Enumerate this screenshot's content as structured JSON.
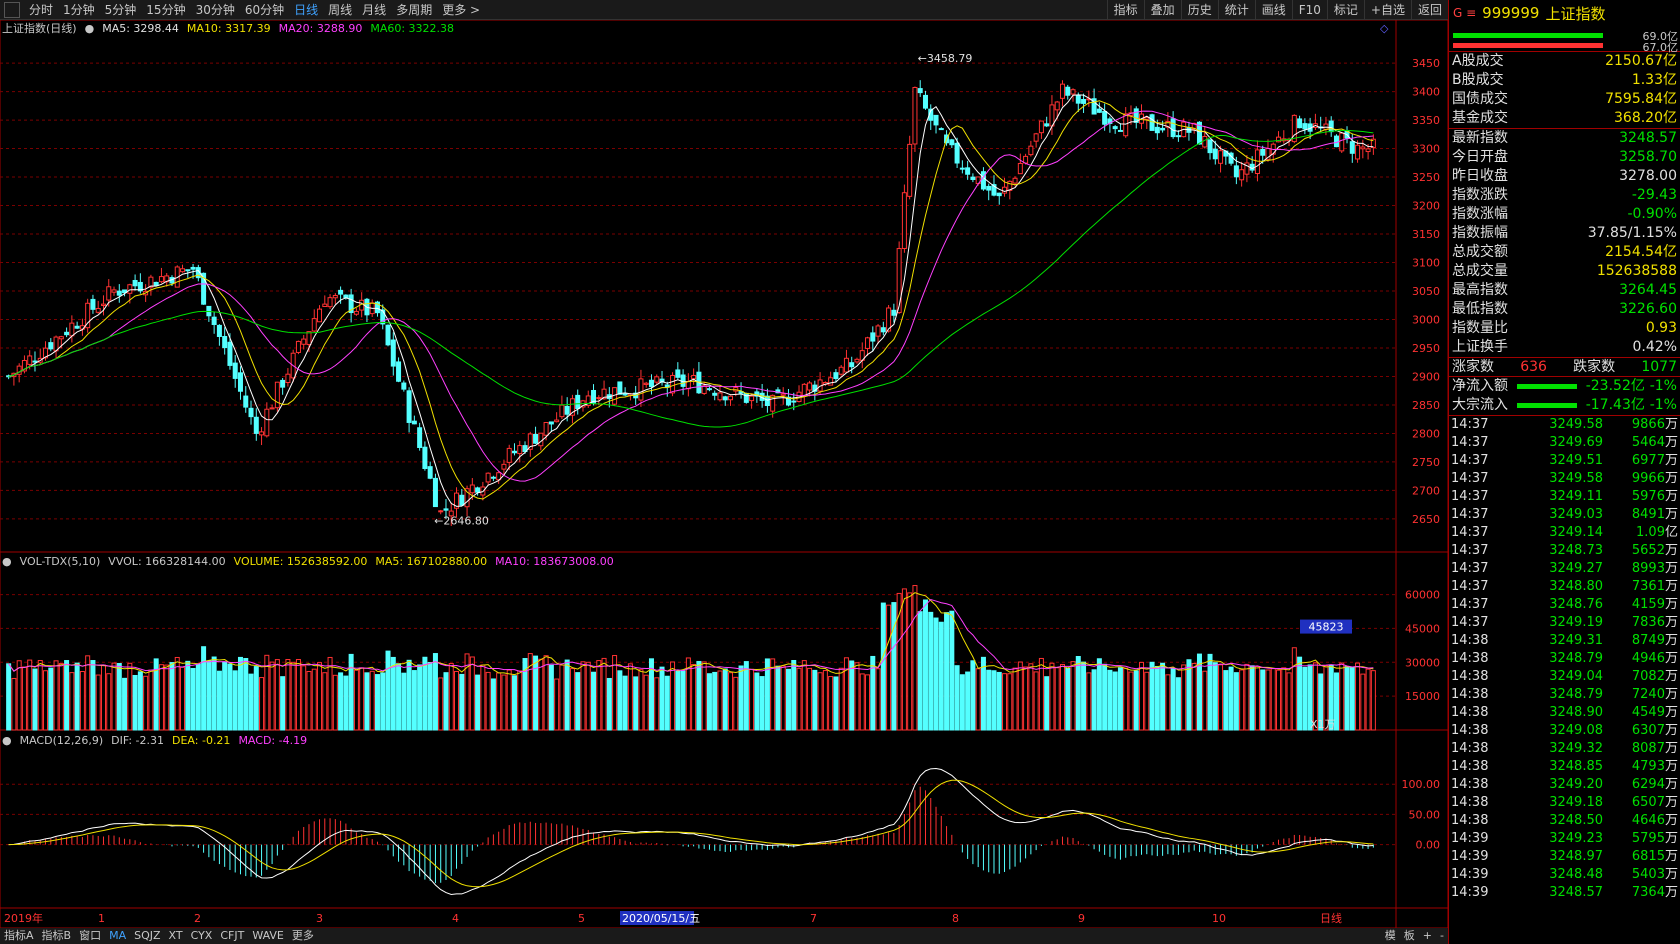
{
  "toolbar": {
    "periods": [
      "分时",
      "1分钟",
      "5分钟",
      "15分钟",
      "30分钟",
      "60分钟",
      "日线",
      "周线",
      "月线",
      "多周期",
      "更多 >"
    ],
    "active_period": "日线",
    "right_buttons": [
      "指标",
      "叠加",
      "历史",
      "统计",
      "画线",
      "F10",
      "标记",
      "+自选",
      "返回"
    ]
  },
  "main_legend": {
    "title": "上证指数(日线)",
    "ma5": "MA5: 3298.44",
    "ma10": "MA10: 3317.39",
    "ma20": "MA20: 3288.90",
    "ma60": "MA60: 3322.38",
    "high_label": "3458.79",
    "low_label": "2646.80"
  },
  "vol_legend": {
    "name": "VOL-TDX(5,10)",
    "vvol": "VVOL: 166328144.00",
    "volume": "VOLUME: 152638592.00",
    "ma5": "MA5: 167102880.00",
    "ma10": "MA10: 183673008.00",
    "cursor_value": "45823",
    "unit": "X1万"
  },
  "macd_legend": {
    "name": "MACD(12,26,9)",
    "dif": "DIF: -2.31",
    "dea": "DEA: -0.21",
    "macd": "MACD: -4.19"
  },
  "axes": {
    "price_ticks": [
      "3450",
      "3400",
      "3350",
      "3300",
      "3250",
      "3200",
      "3150",
      "3100",
      "3050",
      "3000",
      "2950",
      "2900",
      "2850",
      "2800",
      "2750",
      "2700",
      "2650"
    ],
    "vol_ticks": [
      "60000",
      "45000",
      "30000",
      "15000"
    ],
    "macd_ticks": [
      "100.00",
      "50.00",
      "0.00"
    ],
    "x_labels": [
      "2019年",
      "1",
      "2",
      "3",
      "4",
      "5",
      "2020/05/15/五",
      "7",
      "8",
      "9",
      "10",
      "日线"
    ]
  },
  "colors": {
    "up": "#ff3232",
    "down": "#54ffff",
    "ma5": "#ffffff",
    "ma10": "#f0e000",
    "ma20": "#ff40ff",
    "ma60": "#00e000",
    "grid": "#7a0000"
  },
  "chart_data": {
    "type": "candlestick",
    "ylim": [
      2620,
      3480
    ],
    "closes_key_points": [
      [
        0,
        2900
      ],
      [
        20,
        3050
      ],
      [
        35,
        3090
      ],
      [
        47,
        2800
      ],
      [
        60,
        3040
      ],
      [
        70,
        3010
      ],
      [
        82,
        2660
      ],
      [
        95,
        2760
      ],
      [
        110,
        2870
      ],
      [
        130,
        2890
      ],
      [
        145,
        2850
      ],
      [
        160,
        2920
      ],
      [
        168,
        3020
      ],
      [
        172,
        3400
      ],
      [
        178,
        3300
      ],
      [
        188,
        3210
      ],
      [
        200,
        3400
      ],
      [
        210,
        3350
      ],
      [
        225,
        3330
      ],
      [
        233,
        3250
      ],
      [
        245,
        3350
      ],
      [
        256,
        3300
      ]
    ],
    "vol_ylim": [
      0,
      70000
    ],
    "macd_ylim": [
      -105,
      160
    ]
  },
  "sidebar": {
    "code_prefix": "G ≡",
    "code": "999999",
    "name": "上证指数",
    "bar_top_val": "69.0亿",
    "bar_bot_val": "67.0亿",
    "turnover": [
      {
        "k": "A股成交",
        "v": "2150.67亿",
        "c": "#f0e000"
      },
      {
        "k": "B股成交",
        "v": "1.33亿",
        "c": "#f0e000"
      },
      {
        "k": "国债成交",
        "v": "7595.84亿",
        "c": "#f0e000"
      },
      {
        "k": "基金成交",
        "v": "368.20亿",
        "c": "#f0e000"
      }
    ],
    "stats": [
      {
        "k": "最新指数",
        "v": "3248.57",
        "c": "#00e000"
      },
      {
        "k": "今日开盘",
        "v": "3258.70",
        "c": "#00e000"
      },
      {
        "k": "昨日收盘",
        "v": "3278.00",
        "c": "#e0e0e0"
      },
      {
        "k": "指数涨跌",
        "v": "-29.43",
        "c": "#00e000"
      },
      {
        "k": "指数涨幅",
        "v": "-0.90%",
        "c": "#00e000"
      },
      {
        "k": "指数振幅",
        "v": "37.85/1.15%",
        "c": "#e0e0e0"
      },
      {
        "k": "总成交额",
        "v": "2154.54亿",
        "c": "#f0e000"
      },
      {
        "k": "总成交量",
        "v": "152638588",
        "c": "#f0e000"
      },
      {
        "k": "最高指数",
        "v": "3264.45",
        "c": "#00e000"
      },
      {
        "k": "最低指数",
        "v": "3226.60",
        "c": "#00e000"
      },
      {
        "k": "指数量比",
        "v": "0.93",
        "c": "#f0e000"
      },
      {
        "k": "上证换手",
        "v": "0.42%",
        "c": "#e0e0e0"
      }
    ],
    "updown": {
      "up_label": "涨家数",
      "up": "636",
      "down_label": "跌家数",
      "down": "1077"
    },
    "flows": [
      {
        "k": "净流入额",
        "v": "-23.52亿",
        "p": "-1%"
      },
      {
        "k": "大宗流入",
        "v": "-17.43亿",
        "p": "-1%"
      }
    ],
    "ticks": [
      {
        "t": "14:37",
        "p": "3249.58",
        "v": "9866",
        "u": "万"
      },
      {
        "t": "14:37",
        "p": "3249.69",
        "v": "5464",
        "u": "万"
      },
      {
        "t": "14:37",
        "p": "3249.51",
        "v": "6977",
        "u": "万"
      },
      {
        "t": "14:37",
        "p": "3249.58",
        "v": "9966",
        "u": "万"
      },
      {
        "t": "14:37",
        "p": "3249.11",
        "v": "5976",
        "u": "万"
      },
      {
        "t": "14:37",
        "p": "3249.03",
        "v": "8491",
        "u": "万"
      },
      {
        "t": "14:37",
        "p": "3249.14",
        "v": "1.09",
        "u": "亿"
      },
      {
        "t": "14:37",
        "p": "3248.73",
        "v": "5652",
        "u": "万"
      },
      {
        "t": "14:37",
        "p": "3249.27",
        "v": "8993",
        "u": "万"
      },
      {
        "t": "14:37",
        "p": "3248.80",
        "v": "7361",
        "u": "万"
      },
      {
        "t": "14:37",
        "p": "3248.76",
        "v": "4159",
        "u": "万"
      },
      {
        "t": "14:37",
        "p": "3249.19",
        "v": "7836",
        "u": "万"
      },
      {
        "t": "14:38",
        "p": "3249.31",
        "v": "8749",
        "u": "万"
      },
      {
        "t": "14:38",
        "p": "3248.79",
        "v": "4946",
        "u": "万"
      },
      {
        "t": "14:38",
        "p": "3249.04",
        "v": "7082",
        "u": "万"
      },
      {
        "t": "14:38",
        "p": "3248.79",
        "v": "7240",
        "u": "万"
      },
      {
        "t": "14:38",
        "p": "3248.90",
        "v": "4549",
        "u": "万"
      },
      {
        "t": "14:38",
        "p": "3249.08",
        "v": "6307",
        "u": "万"
      },
      {
        "t": "14:38",
        "p": "3249.32",
        "v": "8087",
        "u": "万"
      },
      {
        "t": "14:38",
        "p": "3248.85",
        "v": "4793",
        "u": "万"
      },
      {
        "t": "14:38",
        "p": "3249.20",
        "v": "6294",
        "u": "万"
      },
      {
        "t": "14:38",
        "p": "3249.18",
        "v": "6507",
        "u": "万"
      },
      {
        "t": "14:38",
        "p": "3248.50",
        "v": "4646",
        "u": "万"
      },
      {
        "t": "14:39",
        "p": "3249.23",
        "v": "5795",
        "u": "万"
      },
      {
        "t": "14:39",
        "p": "3248.97",
        "v": "6815",
        "u": "万"
      },
      {
        "t": "14:39",
        "p": "3248.48",
        "v": "5403",
        "u": "万"
      },
      {
        "t": "14:39",
        "p": "3248.57",
        "v": "7364",
        "u": "万"
      }
    ]
  },
  "bottom": {
    "tabs": [
      "指标A",
      "指标B",
      "窗口",
      "MA",
      "SQJZ",
      "XT",
      "CYX",
      "CFJT",
      "WAVE",
      "更多"
    ],
    "active_tab": "MA",
    "right": [
      "模",
      "板",
      "+",
      "-"
    ]
  }
}
